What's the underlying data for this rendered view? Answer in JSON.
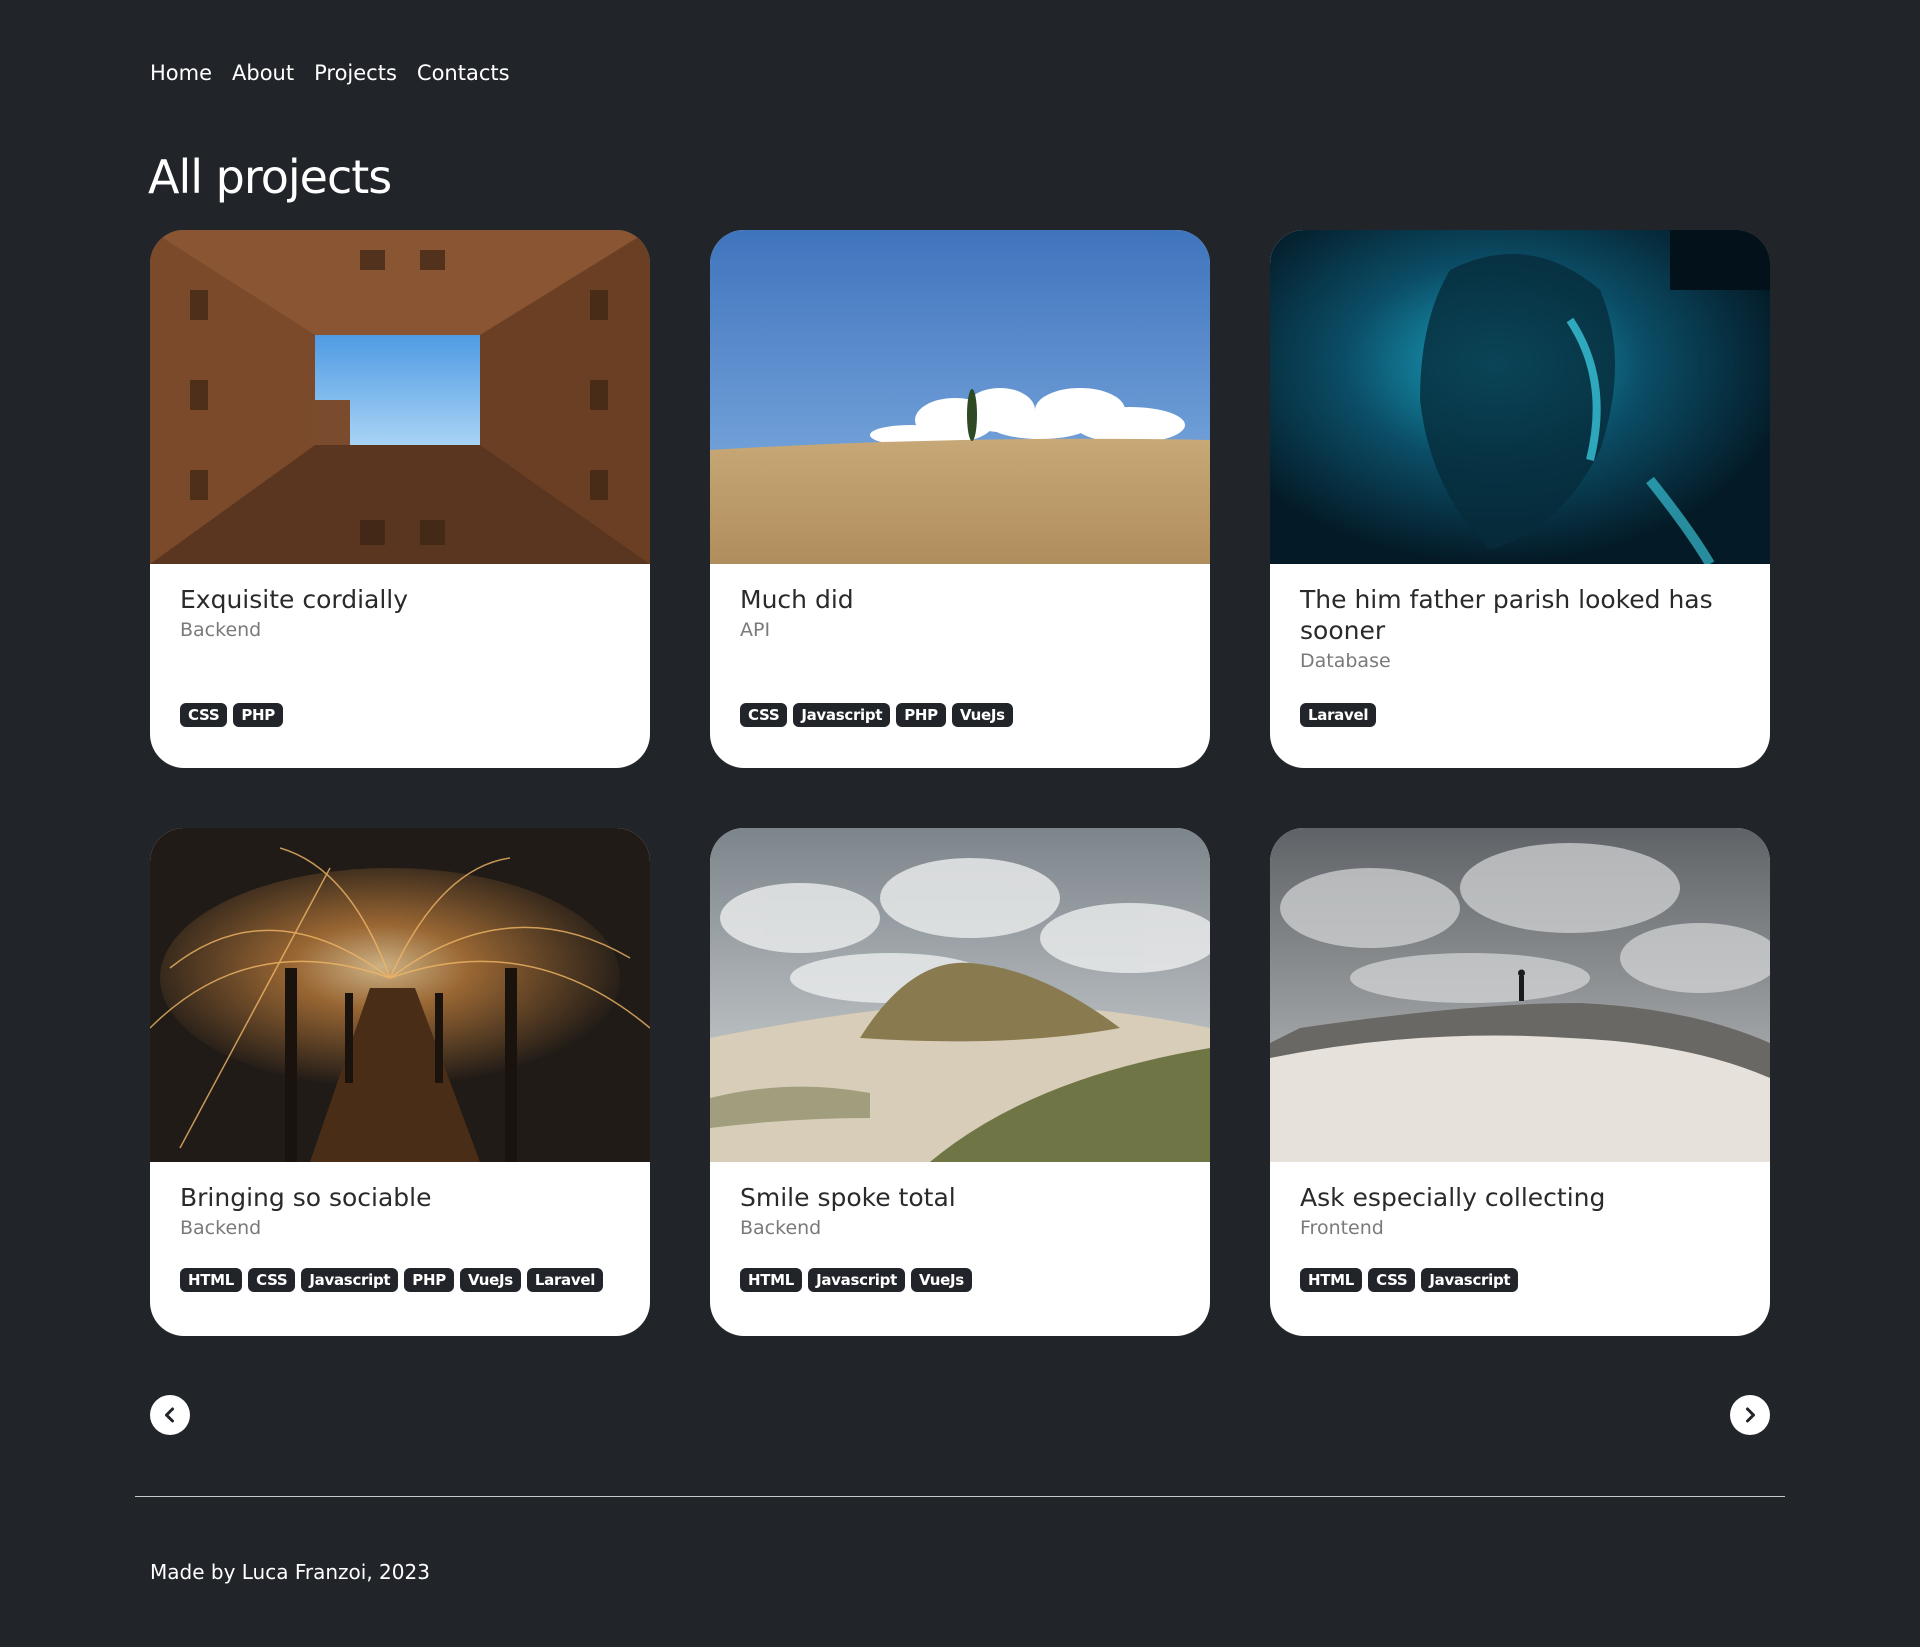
{
  "nav": {
    "items": [
      "Home",
      "About",
      "Projects",
      "Contacts"
    ]
  },
  "page": {
    "title": "All projects"
  },
  "projects": [
    {
      "title": "Exquisite cordially",
      "category": "Backend",
      "tags": [
        "CSS",
        "PHP"
      ]
    },
    {
      "title": "Much did",
      "category": "API",
      "tags": [
        "CSS",
        "Javascript",
        "PHP",
        "VueJs"
      ]
    },
    {
      "title": "The him father parish looked has sooner",
      "category": "Database",
      "tags": [
        "Laravel"
      ]
    },
    {
      "title": "Bringing so sociable",
      "category": "Backend",
      "tags": [
        "HTML",
        "CSS",
        "Javascript",
        "PHP",
        "VueJs",
        "Laravel"
      ]
    },
    {
      "title": "Smile spoke total",
      "category": "Backend",
      "tags": [
        "HTML",
        "Javascript",
        "VueJs"
      ]
    },
    {
      "title": "Ask especially collecting",
      "category": "Frontend",
      "tags": [
        "HTML",
        "CSS",
        "Javascript"
      ]
    }
  ],
  "pagination": {
    "prev_icon": "chevron-left-icon",
    "next_icon": "chevron-right-icon"
  },
  "footer": {
    "text": "Made by Luca Franzoi, 2023"
  },
  "colors": {
    "background": "#212429",
    "card": "#ffffff",
    "tag_bg": "#212429"
  }
}
